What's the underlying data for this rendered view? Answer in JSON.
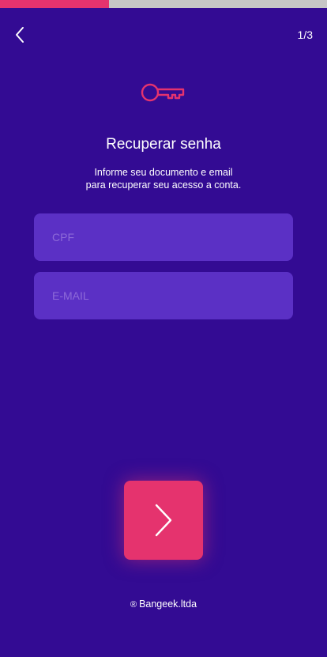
{
  "progress": {
    "value": 0.333,
    "fill_color": "#e5336e",
    "track_color": "#c6c6c6"
  },
  "header": {
    "back_icon": "chevron-left-icon",
    "step_counter": "1/3"
  },
  "hero": {
    "icon": "key-icon",
    "icon_color": "#e5336e"
  },
  "title": "Recuperar senha",
  "subtitle": {
    "line1": "Informe seu documento e email",
    "line2": "para recuperar seu acesso a conta."
  },
  "form": {
    "cpf": {
      "placeholder": "CPF",
      "value": ""
    },
    "email": {
      "placeholder": "E-MAIL",
      "value": ""
    }
  },
  "next_button": {
    "icon": "chevron-right-icon",
    "color": "#e5336e"
  },
  "footer": {
    "symbol": "®",
    "company": "Bangeek.ltda"
  },
  "colors": {
    "background": "#330b93",
    "field_background": "#5b30c5",
    "placeholder": "#8d6ad8"
  }
}
